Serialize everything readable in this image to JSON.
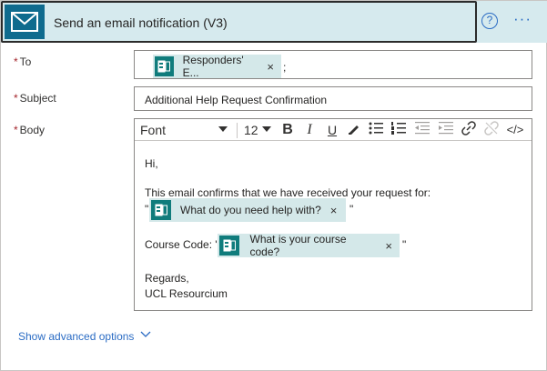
{
  "header": {
    "title": "Send an email notification (V3)",
    "help_glyph": "?",
    "more_glyph": "···"
  },
  "fields": {
    "to": {
      "required_mark": "*",
      "label": "To",
      "token_text": "Responders' E...",
      "trailing": ";"
    },
    "subject": {
      "required_mark": "*",
      "label": "Subject",
      "value": "Additional Help Request Confirmation"
    },
    "body": {
      "required_mark": "*",
      "label": "Body",
      "toolbar": {
        "font": "Font",
        "size": "12",
        "bold": "B",
        "italic": "I",
        "underline": "U",
        "code": "</>"
      },
      "greeting": "Hi,",
      "line1": "This email confirms that we have received your request for:",
      "token1_text": "What do you need help with?",
      "course_label": "Course Code: \"",
      "token2_text": "What is your course code?",
      "regards": "Regards,",
      "signature": "UCL Resourcium"
    }
  },
  "token_close": "×",
  "quote_open": "\"",
  "quote_close": "\"",
  "advanced": {
    "label": "Show advanced options"
  },
  "colors": {
    "header_bg": "#d6eaee",
    "mail_tile": "#0f6b8e",
    "token_bg": "#d4e8e9",
    "token_icon": "#107c7c",
    "link": "#2b6cc4",
    "required": "#a4262c"
  },
  "icons": {
    "header": "mail-icon",
    "token": "forms-icon",
    "help": "help-circle-icon",
    "more": "more-horizontal-icon",
    "advanced": "chevron-down-icon"
  }
}
